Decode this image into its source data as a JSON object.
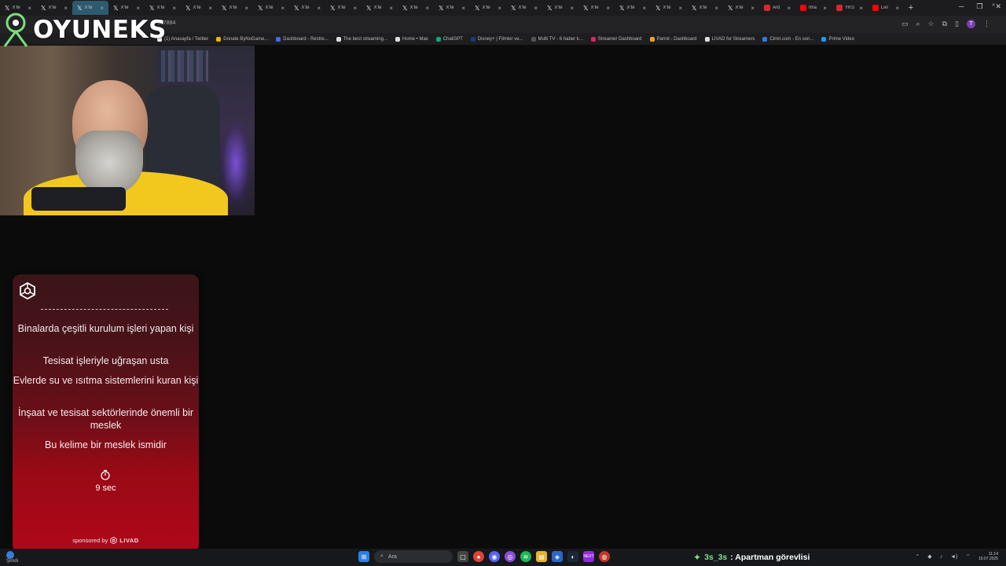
{
  "browser": {
    "tabs": [
      {
        "label": "X'te",
        "icon": "x-logo-icon",
        "active": false
      },
      {
        "label": "X'te",
        "icon": "x-logo-icon",
        "active": false
      },
      {
        "label": "X'te",
        "icon": "x-logo-icon",
        "active": true
      },
      {
        "label": "X'te",
        "icon": "x-logo-icon",
        "active": false
      },
      {
        "label": "X'te",
        "icon": "x-logo-icon",
        "active": false
      },
      {
        "label": "X'te",
        "icon": "x-logo-icon",
        "active": false
      },
      {
        "label": "X'te",
        "icon": "x-logo-icon",
        "active": false
      },
      {
        "label": "X'te",
        "icon": "x-logo-icon",
        "active": false
      },
      {
        "label": "X'te",
        "icon": "x-logo-icon",
        "active": false
      },
      {
        "label": "X'te",
        "icon": "x-logo-icon",
        "active": false
      },
      {
        "label": "X'te",
        "icon": "x-logo-icon",
        "active": false
      },
      {
        "label": "X'te",
        "icon": "x-logo-icon",
        "active": false
      },
      {
        "label": "X'te",
        "icon": "x-logo-icon",
        "active": false
      },
      {
        "label": "X'te",
        "icon": "x-logo-icon",
        "active": false
      },
      {
        "label": "X'te",
        "icon": "x-logo-icon",
        "active": false
      },
      {
        "label": "X'te",
        "icon": "x-logo-icon",
        "active": false
      },
      {
        "label": "X'te",
        "icon": "x-logo-icon",
        "active": false
      },
      {
        "label": "X'te",
        "icon": "x-logo-icon",
        "active": false
      },
      {
        "label": "X'te",
        "icon": "x-logo-icon",
        "active": false
      },
      {
        "label": "X'te",
        "icon": "x-logo-icon",
        "active": false
      },
      {
        "label": "X'te",
        "icon": "x-logo-icon",
        "active": false
      },
      {
        "label": "Ard",
        "icon": "red-favicon",
        "active": false
      },
      {
        "label": "İma",
        "icon": "youtube-icon",
        "active": false
      },
      {
        "label": "YKS",
        "icon": "red-favicon",
        "active": false
      },
      {
        "label": "Livi",
        "icon": "youtube-icon",
        "active": false
      }
    ],
    "url_fragment": "997884",
    "bookmarks": [
      {
        "label": "(1) Anasayfa / Twitter",
        "color": "#eeeeee"
      },
      {
        "label": "Donate ByNoGame...",
        "color": "#f0b400"
      },
      {
        "label": "Dashboard - Restre...",
        "color": "#3e6ee8"
      },
      {
        "label": "The best streaming...",
        "color": "#dddddd"
      },
      {
        "label": "Home • Max",
        "color": "#dddddd"
      },
      {
        "label": "ChatGPT",
        "color": "#10a37f"
      },
      {
        "label": "Disney+ | Filmler ve...",
        "color": "#1b3a7a"
      },
      {
        "label": "Multi TV - 6 haber k...",
        "color": "#555555"
      },
      {
        "label": "Streamer Dashboard",
        "color": "#e0245e"
      },
      {
        "label": "Parrot - Dashboard",
        "color": "#f0a020"
      },
      {
        "label": "LIVAD for Streamers",
        "color": "#dddddd"
      },
      {
        "label": "Cimri.com - En son...",
        "color": "#2a7de1"
      },
      {
        "label": "Prime Video",
        "color": "#1a98ff"
      }
    ],
    "profile_initial": "T"
  },
  "overlay": {
    "logo_text": "OYUNEKS"
  },
  "quiz": {
    "clues": [
      "Binalarda çeşitli kurulum işleri yapan kişi",
      "Tesisat işleriyle uğraşan usta",
      "Evlerde su ve ısıtma sistemlerini kuran kişi",
      "İnşaat ve tesisat sektörlerinde önemli bir meslek",
      "Bu kelime bir meslek ismidir"
    ],
    "timer": "9 sec",
    "sponsor_prefix": "sponsored by",
    "sponsor_brand": "LIVAD"
  },
  "taskbar": {
    "left_label": "Şimdi",
    "search_placeholder": "Ara",
    "game_user": "3s_3s",
    "game_text": ": Apartman görevlisi",
    "time": "11:14",
    "date": "19.07.2025"
  },
  "colors": {
    "accent_green": "#7de08a",
    "quiz_red": "#b0071a",
    "logo_green": "#7be07b"
  }
}
